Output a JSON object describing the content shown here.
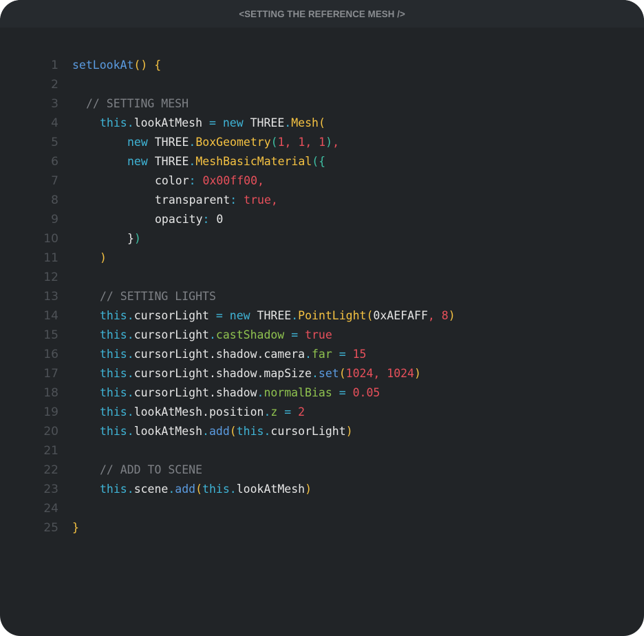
{
  "window": {
    "title": "<SETTING THE REFERENCE MESH  />"
  },
  "colors": {
    "background": "#212427",
    "titlebar": "#262a2e",
    "line_number": "#4e5257",
    "comment": "#7e8186",
    "keyword": "#3fb4d6",
    "function": "#5b9be0",
    "class": "#f5c242",
    "number": "#e8505b",
    "property": "#8fc24f"
  },
  "code": {
    "language": "javascript",
    "lines": [
      {
        "n": "1",
        "indent": "0",
        "tokens": [
          [
            "fn",
            "setLookAt"
          ],
          [
            "brace",
            "()"
          ],
          [
            "plain",
            " "
          ],
          [
            "brace",
            "{"
          ]
        ]
      },
      {
        "n": "2",
        "indent": "0",
        "tokens": []
      },
      {
        "n": "3",
        "indent": "1",
        "tokens": [
          [
            "comment",
            "// SETTING MESH"
          ]
        ]
      },
      {
        "n": "4",
        "indent": "2",
        "tokens": [
          [
            "this",
            "this"
          ],
          [
            "dot",
            "."
          ],
          [
            "plain",
            "lookAtMesh "
          ],
          [
            "punc",
            "="
          ],
          [
            "plain",
            " "
          ],
          [
            "kw",
            "new"
          ],
          [
            "plain",
            " THREE"
          ],
          [
            "dot",
            "."
          ],
          [
            "class",
            "Mesh"
          ],
          [
            "paren",
            "("
          ]
        ]
      },
      {
        "n": "5",
        "indent": "4",
        "tokens": [
          [
            "kw",
            "new"
          ],
          [
            "plain",
            " THREE"
          ],
          [
            "dot",
            "."
          ],
          [
            "class",
            "BoxGeometry"
          ],
          [
            "paren2",
            "("
          ],
          [
            "num",
            "1, 1, 1"
          ],
          [
            "paren2",
            ")"
          ],
          [
            "num",
            ","
          ]
        ]
      },
      {
        "n": "6",
        "indent": "4",
        "tokens": [
          [
            "kw",
            "new"
          ],
          [
            "plain",
            " THREE"
          ],
          [
            "dot",
            "."
          ],
          [
            "class",
            "MeshBasicMaterial"
          ],
          [
            "paren2",
            "({"
          ]
        ]
      },
      {
        "n": "7",
        "indent": "6",
        "tokens": [
          [
            "plain",
            "color"
          ],
          [
            "punc",
            ":"
          ],
          [
            "plain",
            " "
          ],
          [
            "num",
            "0x00ff00,"
          ]
        ]
      },
      {
        "n": "8",
        "indent": "6",
        "tokens": [
          [
            "plain",
            "transparent"
          ],
          [
            "punc",
            ":"
          ],
          [
            "plain",
            " "
          ],
          [
            "num",
            "true,"
          ]
        ]
      },
      {
        "n": "9",
        "indent": "6",
        "tokens": [
          [
            "plain",
            "opacity"
          ],
          [
            "punc",
            ":"
          ],
          [
            "plain",
            " 0"
          ]
        ]
      },
      {
        "n": "10",
        "indent": "4",
        "tokens": [
          [
            "plain",
            "}"
          ],
          [
            "paren2",
            ")"
          ]
        ]
      },
      {
        "n": "11",
        "indent": "2",
        "tokens": [
          [
            "paren",
            ")"
          ]
        ]
      },
      {
        "n": "12",
        "indent": "0",
        "tokens": []
      },
      {
        "n": "13",
        "indent": "2",
        "tokens": [
          [
            "comment",
            "// SETTING LIGHTS"
          ]
        ]
      },
      {
        "n": "14",
        "indent": "2",
        "tokens": [
          [
            "this",
            "this"
          ],
          [
            "dot",
            "."
          ],
          [
            "plain",
            "cursorLight "
          ],
          [
            "punc",
            "="
          ],
          [
            "plain",
            " "
          ],
          [
            "kw",
            "new"
          ],
          [
            "plain",
            " THREE"
          ],
          [
            "dot",
            "."
          ],
          [
            "class",
            "PointLight"
          ],
          [
            "paren",
            "("
          ],
          [
            "plain",
            "0xAEFAFF"
          ],
          [
            "num",
            ", 8"
          ],
          [
            "paren",
            ")"
          ]
        ]
      },
      {
        "n": "15",
        "indent": "2",
        "tokens": [
          [
            "this",
            "this"
          ],
          [
            "dot",
            "."
          ],
          [
            "plain",
            "cursorLight"
          ],
          [
            "dot",
            "."
          ],
          [
            "prop",
            "castShadow"
          ],
          [
            "plain",
            " "
          ],
          [
            "punc",
            "="
          ],
          [
            "plain",
            " "
          ],
          [
            "num",
            "true"
          ]
        ]
      },
      {
        "n": "16",
        "indent": "2",
        "tokens": [
          [
            "this",
            "this"
          ],
          [
            "dot",
            "."
          ],
          [
            "plain",
            "cursorLight.shadow.camera"
          ],
          [
            "dot",
            "."
          ],
          [
            "prop",
            "far"
          ],
          [
            "plain",
            " "
          ],
          [
            "punc",
            "="
          ],
          [
            "plain",
            " "
          ],
          [
            "num",
            "15"
          ]
        ]
      },
      {
        "n": "17",
        "indent": "2",
        "tokens": [
          [
            "this",
            "this"
          ],
          [
            "dot",
            "."
          ],
          [
            "plain",
            "cursorLight.shadow.mapSize"
          ],
          [
            "dot",
            "."
          ],
          [
            "method",
            "set"
          ],
          [
            "paren",
            "("
          ],
          [
            "num",
            "1024, 1024"
          ],
          [
            "paren",
            ")"
          ]
        ]
      },
      {
        "n": "18",
        "indent": "2",
        "tokens": [
          [
            "this",
            "this"
          ],
          [
            "dot",
            "."
          ],
          [
            "plain",
            "cursorLight.shadow"
          ],
          [
            "dot",
            "."
          ],
          [
            "prop",
            "normalBias"
          ],
          [
            "plain",
            " "
          ],
          [
            "punc",
            "="
          ],
          [
            "plain",
            " "
          ],
          [
            "num",
            "0.05"
          ]
        ]
      },
      {
        "n": "19",
        "indent": "2",
        "tokens": [
          [
            "this",
            "this"
          ],
          [
            "dot",
            "."
          ],
          [
            "plain",
            "lookAtMesh.position"
          ],
          [
            "dot",
            "."
          ],
          [
            "prop",
            "z"
          ],
          [
            "plain",
            " "
          ],
          [
            "punc",
            "="
          ],
          [
            "plain",
            " "
          ],
          [
            "num",
            "2"
          ]
        ]
      },
      {
        "n": "20",
        "indent": "2",
        "tokens": [
          [
            "this",
            "this"
          ],
          [
            "dot",
            "."
          ],
          [
            "plain",
            "lookAtMesh"
          ],
          [
            "dot",
            "."
          ],
          [
            "method",
            "add"
          ],
          [
            "paren",
            "("
          ],
          [
            "this",
            "this"
          ],
          [
            "dot",
            "."
          ],
          [
            "plain",
            "cursorLight"
          ],
          [
            "paren",
            ")"
          ]
        ]
      },
      {
        "n": "21",
        "indent": "0",
        "tokens": []
      },
      {
        "n": "22",
        "indent": "2",
        "tokens": [
          [
            "comment",
            "// ADD TO SCENE"
          ]
        ]
      },
      {
        "n": "23",
        "indent": "2",
        "tokens": [
          [
            "this",
            "this"
          ],
          [
            "dot",
            "."
          ],
          [
            "plain",
            "scene"
          ],
          [
            "dot",
            "."
          ],
          [
            "method",
            "add"
          ],
          [
            "paren",
            "("
          ],
          [
            "this",
            "this"
          ],
          [
            "dot",
            "."
          ],
          [
            "plain",
            "lookAtMesh"
          ],
          [
            "paren",
            ")"
          ]
        ]
      },
      {
        "n": "24",
        "indent": "0",
        "tokens": []
      },
      {
        "n": "25",
        "indent": "0",
        "tokens": [
          [
            "brace",
            "}"
          ]
        ]
      }
    ]
  }
}
